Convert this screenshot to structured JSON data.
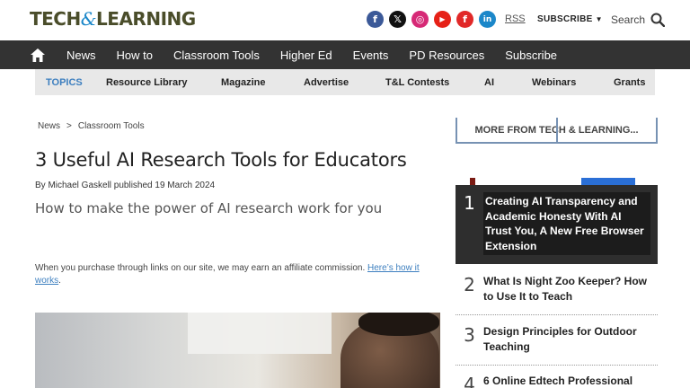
{
  "header": {
    "logo_left": "TECH",
    "logo_amp": "&",
    "logo_right": "LEARNING",
    "socials": [
      {
        "name": "facebook",
        "glyph": "f",
        "color": "#3b5998"
      },
      {
        "name": "x",
        "glyph": "𝕏",
        "color": "#111111"
      },
      {
        "name": "instagram",
        "glyph": "◎",
        "color": "#d62976"
      },
      {
        "name": "youtube",
        "glyph": "▶",
        "color": "#e62117"
      },
      {
        "name": "flipboard",
        "glyph": "f",
        "color": "#e12828"
      },
      {
        "name": "linkedin",
        "glyph": "in",
        "color": "#1b87c9"
      }
    ],
    "rss": "RSS",
    "subscribe": "SUBSCRIBE",
    "search": "Search"
  },
  "nav": {
    "items": [
      "News",
      "How to",
      "Classroom Tools",
      "Higher Ed",
      "Events",
      "PD Resources",
      "Subscribe"
    ]
  },
  "subnav": {
    "topics": "TOPICS",
    "items": [
      "Resource Library",
      "Magazine",
      "Advertise",
      "T&L Contests",
      "AI",
      "Webinars",
      "Grants"
    ]
  },
  "article": {
    "breadcrumb": [
      "News",
      ">",
      "Classroom Tools"
    ],
    "headline": "3 Useful AI Research Tools for Educators",
    "byline": "By Michael Gaskell published 19 March 2024",
    "strapline": "How to make the power of AI research work for you",
    "affiliate_text": "When you purchase through links on our site, we may earn an affiliate commission. ",
    "affiliate_link": "Here’s how it works",
    "affiliate_end": "."
  },
  "sidebar": {
    "more_title": "MORE FROM TECH & LEARNING...",
    "items": [
      {
        "num": "1",
        "title": "Creating AI Transparency and Academic Honesty With AI Trust You, A New Free Browser Extension"
      },
      {
        "num": "2",
        "title": "What Is Night Zoo Keeper? How to Use It to Teach"
      },
      {
        "num": "3",
        "title": "Design Principles for Outdoor Teaching"
      },
      {
        "num": "4",
        "title": "6 Online Edtech Professional"
      }
    ]
  }
}
